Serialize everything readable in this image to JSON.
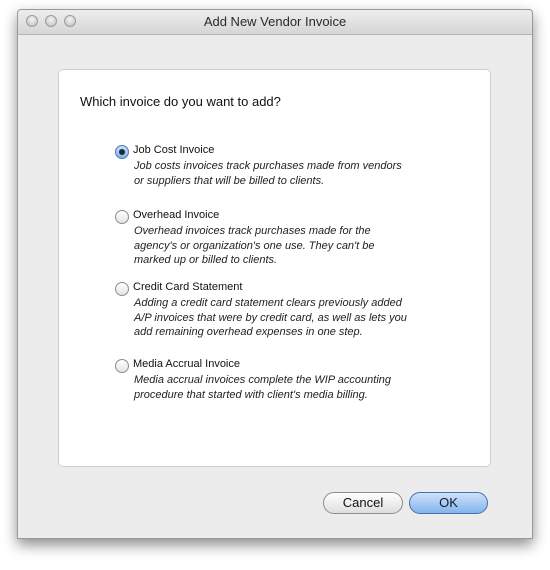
{
  "window": {
    "title": "Add New Vendor Invoice"
  },
  "dialog": {
    "question": "Which invoice do you want to add?",
    "options": [
      {
        "label": "Job Cost Invoice",
        "description": "Job costs invoices track purchases made from vendors\nor suppliers that will be billed to clients.",
        "selected": true
      },
      {
        "label": "Overhead Invoice",
        "description": "Overhead invoices track purchases made for the\nagency's or organization's one use. They can't be\nmarked up or billed to clients.",
        "selected": false
      },
      {
        "label": "Credit Card Statement",
        "description": "Adding a credit card statement clears previously added\nA/P invoices that were by credit card, as well as lets you\nadd remaining overhead expenses in one step.",
        "selected": false
      },
      {
        "label": "Media Accrual Invoice",
        "description": "Media accrual invoices complete the WIP accounting\nprocedure that started with client's media billing.",
        "selected": false
      }
    ]
  },
  "buttons": {
    "cancel_label": "Cancel",
    "ok_label": "OK"
  },
  "icons": {
    "close": "close-button-icon",
    "minimize": "minimize-button-icon",
    "zoom": "zoom-button-icon"
  },
  "colors": {
    "accent": "#82b4ee",
    "window_bg": "#ececec"
  }
}
